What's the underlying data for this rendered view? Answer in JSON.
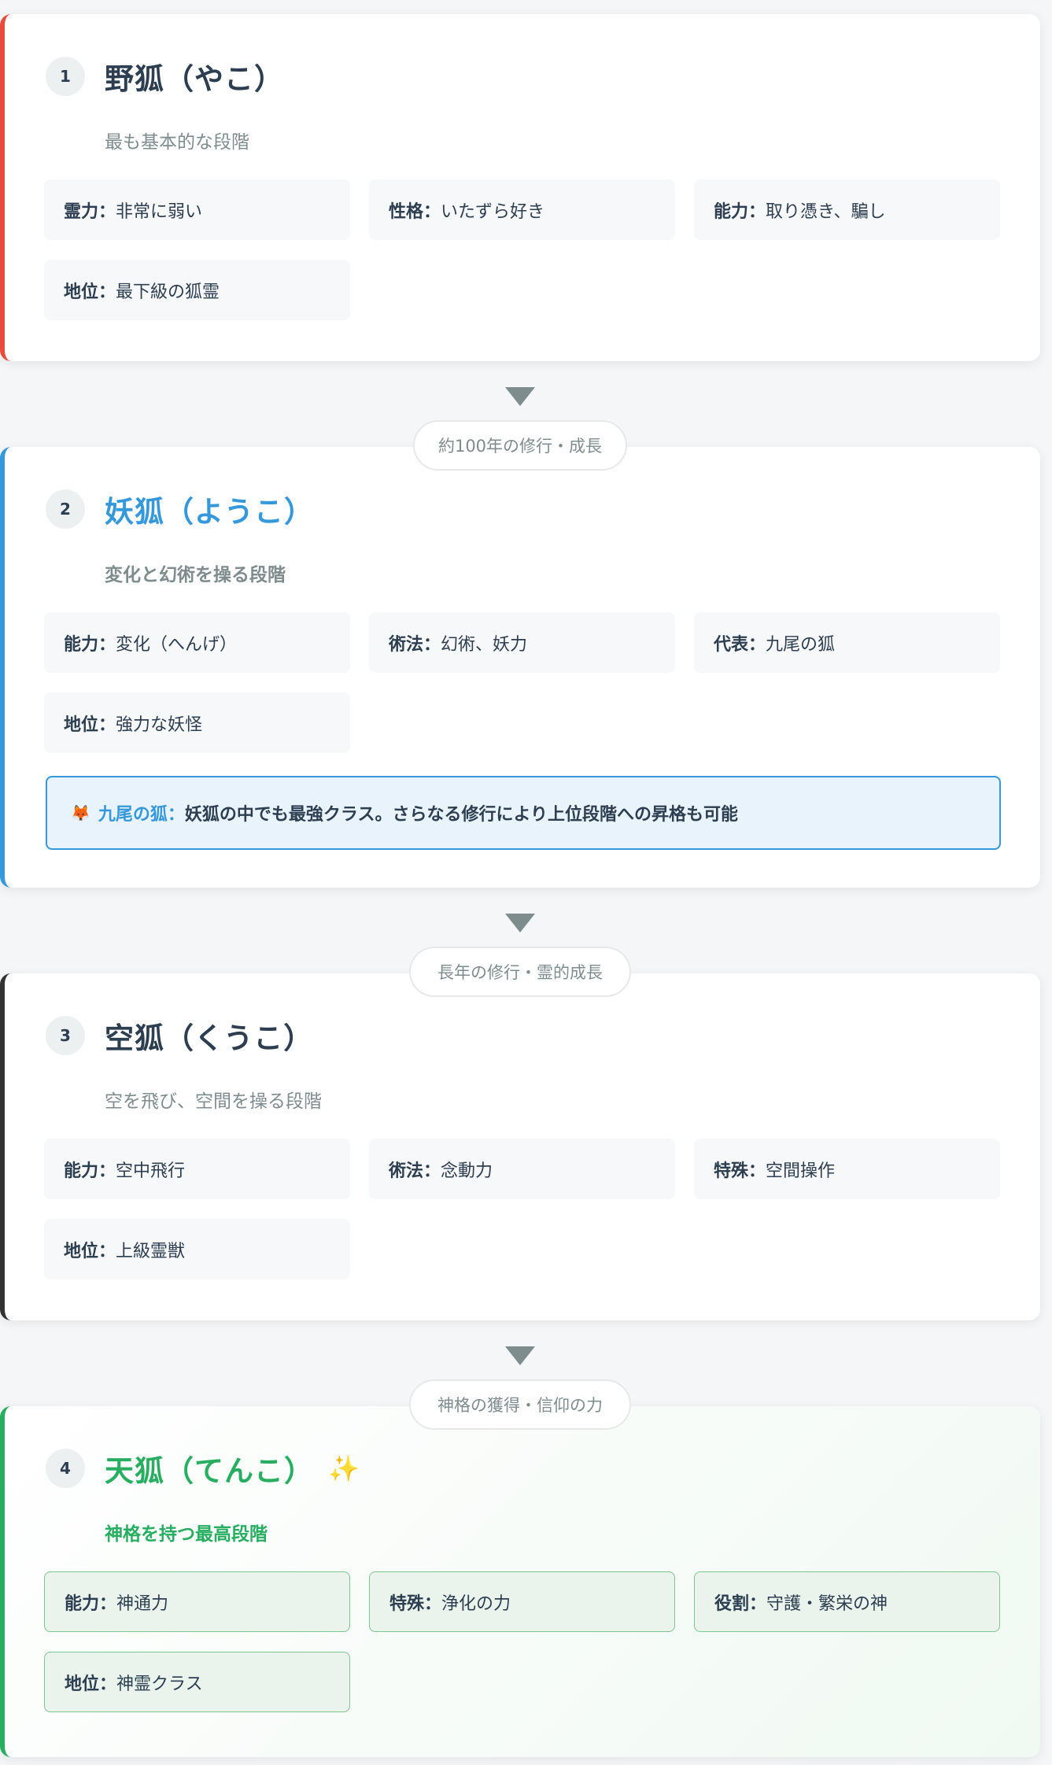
{
  "colors": {
    "stage1": "#e74c3c",
    "stage2": "#3498db",
    "stage3": "#333333",
    "stage4": "#27ae60"
  },
  "stages": [
    {
      "number": "1",
      "title": "野狐（やこ）",
      "subtitle": "最も基本的な段階",
      "items": [
        {
          "key": "霊力：",
          "value": "非常に弱い"
        },
        {
          "key": "性格：",
          "value": "いたずら好き"
        },
        {
          "key": "能力：",
          "value": "取り憑き、騙し"
        },
        {
          "key": "地位：",
          "value": "最下級の狐霊"
        }
      ]
    },
    {
      "number": "2",
      "title": "妖狐（ようこ）",
      "subtitle": "変化と幻術を操る段階",
      "items": [
        {
          "key": "能力：",
          "value": "変化（へんげ）"
        },
        {
          "key": "術法：",
          "value": "幻術、妖力"
        },
        {
          "key": "代表：",
          "value": "九尾の狐"
        },
        {
          "key": "地位：",
          "value": "強力な妖怪"
        }
      ],
      "note": {
        "icon": "fox-icon",
        "label": "九尾の狐：",
        "text": "妖狐の中でも最強クラス。さらなる修行により上位段階への昇格も可能"
      }
    },
    {
      "number": "3",
      "title": "空狐（くうこ）",
      "subtitle": "空を飛び、空間を操る段階",
      "items": [
        {
          "key": "能力：",
          "value": "空中飛行"
        },
        {
          "key": "術法：",
          "value": "念動力"
        },
        {
          "key": "特殊：",
          "value": "空間操作"
        },
        {
          "key": "地位：",
          "value": "上級霊獣"
        }
      ]
    },
    {
      "number": "4",
      "title": "天狐（てんこ）",
      "title_icon": "sparkles-icon",
      "subtitle": "神格を持つ最高段階",
      "items": [
        {
          "key": "能力：",
          "value": "神通力"
        },
        {
          "key": "特殊：",
          "value": "浄化の力"
        },
        {
          "key": "役割：",
          "value": "守護・繁栄の神"
        },
        {
          "key": "地位：",
          "value": "神霊クラス"
        }
      ]
    }
  ],
  "transitions": [
    "約100年の修行・成長",
    "長年の修行・霊的成長",
    "神格の獲得・信仰の力"
  ]
}
